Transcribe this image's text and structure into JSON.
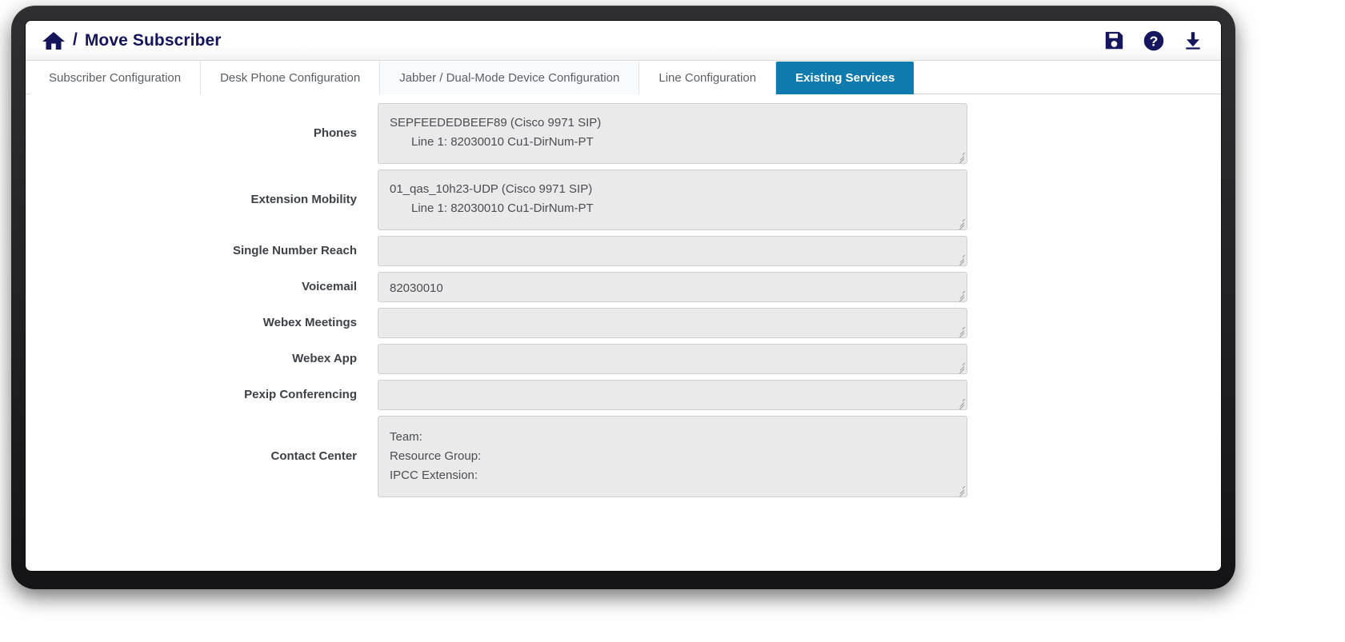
{
  "header": {
    "home_icon": "home-icon",
    "separator": "/",
    "title": "Move Subscriber",
    "actions": [
      {
        "name": "save-icon",
        "label": "Save"
      },
      {
        "name": "help-icon",
        "label": "Help"
      },
      {
        "name": "download-icon",
        "label": "Download"
      }
    ]
  },
  "colors": {
    "accent": "#0f7aad",
    "title": "#15155c",
    "field_bg": "#eaeaea",
    "field_border": "#cfcfcf",
    "bezel": "#232325"
  },
  "tabs": [
    {
      "label": "Subscriber Configuration",
      "active": false
    },
    {
      "label": "Desk Phone Configuration",
      "active": false
    },
    {
      "label": "Jabber / Dual-Mode Device Configuration",
      "active": false
    },
    {
      "label": "Line Configuration",
      "active": false
    },
    {
      "label": "Existing Services",
      "active": true
    }
  ],
  "form": {
    "rows": [
      {
        "label": "Phones",
        "size": "h2",
        "lines": [
          {
            "text": "SEPFEEDEDBEEF89 (Cisco 9971 SIP)",
            "indent": false
          },
          {
            "text": "Line 1: 82030010 Cu1-DirNum-PT",
            "indent": true
          }
        ]
      },
      {
        "label": "Extension Mobility",
        "size": "h2",
        "lines": [
          {
            "text": "01_qas_10h23-UDP (Cisco 9971 SIP)",
            "indent": false
          },
          {
            "text": "Line 1: 82030010 Cu1-DirNum-PT",
            "indent": true
          }
        ]
      },
      {
        "label": "Single Number Reach",
        "size": "h1",
        "lines": []
      },
      {
        "label": "Voicemail",
        "size": "h1",
        "lines": [
          {
            "text": "82030010",
            "indent": false
          }
        ]
      },
      {
        "label": "Webex Meetings",
        "size": "h1",
        "lines": []
      },
      {
        "label": "Webex App",
        "size": "h1",
        "lines": []
      },
      {
        "label": "Pexip Conferencing",
        "size": "h1",
        "lines": []
      },
      {
        "label": "Contact Center",
        "size": "h3",
        "lines": [
          {
            "text": "Team:",
            "indent": false
          },
          {
            "text": "Resource Group:",
            "indent": false
          },
          {
            "text": "IPCC Extension:",
            "indent": false
          }
        ]
      }
    ]
  }
}
